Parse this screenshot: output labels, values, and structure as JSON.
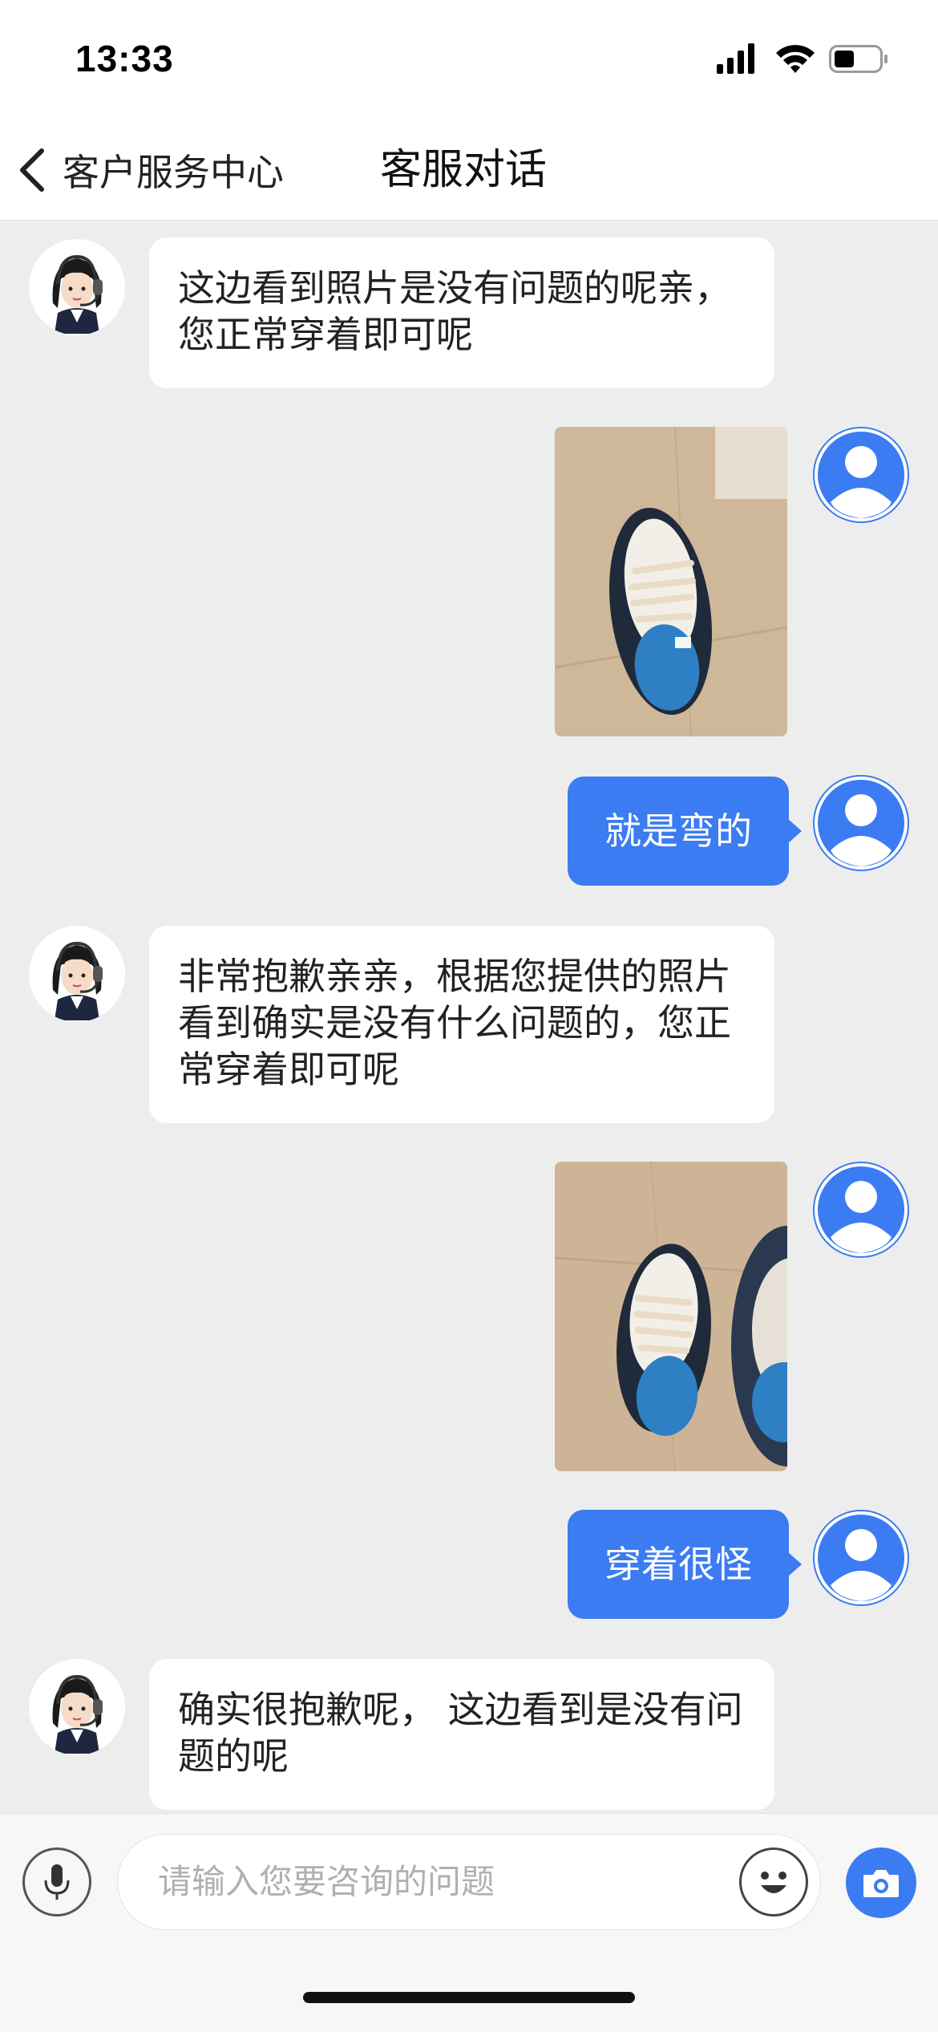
{
  "status_bar": {
    "time": "13:33"
  },
  "nav": {
    "back_label": "客户服务中心",
    "title": "客服对话"
  },
  "messages": {
    "m1": {
      "sender": "agent",
      "text": "这边看到照片是没有问题的呢亲，您正常穿着即可呢"
    },
    "m2": {
      "sender": "user",
      "type": "image",
      "icon": "sneaker-photo"
    },
    "m3": {
      "sender": "user",
      "text": "就是弯的"
    },
    "m4": {
      "sender": "agent",
      "text": "非常抱歉亲亲，根据您提供的照片看到确实是没有什么问题的，您正常穿着即可呢"
    },
    "m5": {
      "sender": "user",
      "type": "image",
      "icon": "sneaker-photo"
    },
    "m6": {
      "sender": "user",
      "text": "穿着很怪"
    },
    "m7": {
      "sender": "agent",
      "text": "确实很抱歉呢， 这边看到是没有问题的呢"
    }
  },
  "input": {
    "placeholder": "请输入您要咨询的问题"
  },
  "colors": {
    "accent": "#3b7cf2",
    "background": "#ededed",
    "bubble_agent": "#ffffff"
  }
}
